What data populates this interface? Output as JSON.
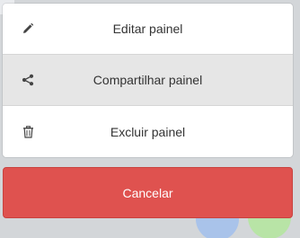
{
  "action_sheet": {
    "items": [
      {
        "label": "Editar painel",
        "icon": "pencil-icon"
      },
      {
        "label": "Compartilhar painel",
        "icon": "share-icon"
      },
      {
        "label": "Excluir painel",
        "icon": "trash-icon"
      }
    ],
    "cancel_label": "Cancelar"
  },
  "colors": {
    "cancel": "#df524f",
    "highlight": "#e6e6e6",
    "text": "#333333"
  }
}
